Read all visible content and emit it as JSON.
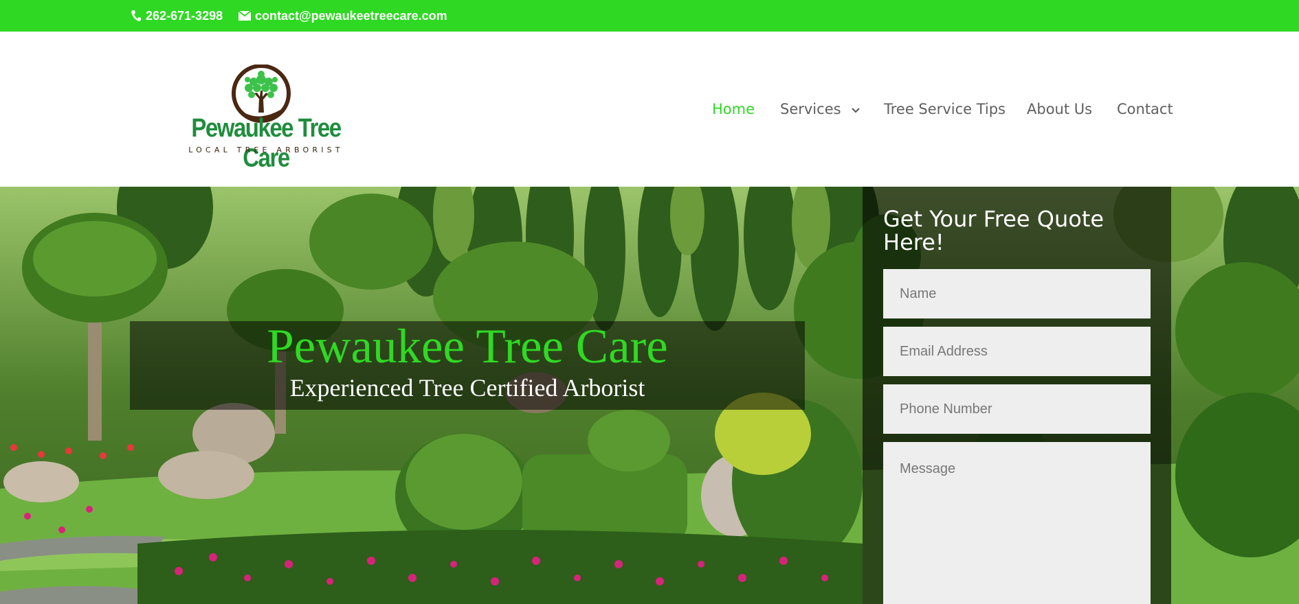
{
  "topbar": {
    "phone": "262-671-3298",
    "email": "contact@pewaukeetreecare.com",
    "bg_color": "#2fd923",
    "phone_icon": "phone-icon",
    "email_icon": "envelope-icon"
  },
  "logo": {
    "name": "Pewaukee Tree Care",
    "tagline": "LOCAL TREE ARBORIST"
  },
  "nav": {
    "items": [
      {
        "label": "Home",
        "active": true
      },
      {
        "label": "Services",
        "has_dropdown": true
      },
      {
        "label": "Tree Service Tips"
      },
      {
        "label": "About Us"
      },
      {
        "label": "Contact"
      }
    ],
    "active_color": "#2fd923"
  },
  "hero": {
    "title": "Pewaukee Tree Care",
    "subtitle": "Experienced Tree Certified Arborist"
  },
  "quote_form": {
    "heading": "Get Your Free Quote Here!",
    "name_placeholder": "Name",
    "email_placeholder": "Email Address",
    "phone_placeholder": "Phone Number",
    "message_placeholder": "Message"
  }
}
